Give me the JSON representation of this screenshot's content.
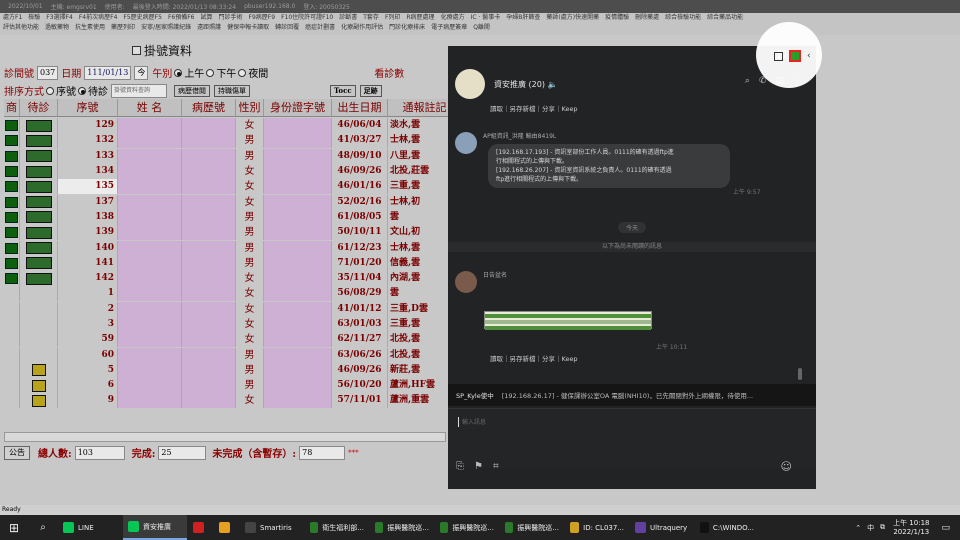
{
  "titlebar": {
    "items": [
      "2022/10/01",
      "主機: emgsrv01",
      "使用者:",
      "最後登入時間: 2022/01/13 08:33:24",
      "pbuser192.168.0",
      "登入: 20050325"
    ]
  },
  "menu": {
    "row1": [
      "處方F1",
      "檢驗",
      "F3選擇F4",
      "F4前次病歷F4",
      "F5歷史病歷F5",
      "F6預備F6",
      "試算",
      "門診手術",
      "F9病歷F9",
      "F10住院許可證F10",
      "診斷書",
      "T套存",
      "F列印",
      "R病歷處理",
      "化療處方",
      "IC · 醫事卡",
      "孕婦B肝篩查",
      "藥師(處方)快速開藥",
      "疫情體驗",
      "刪除藥處",
      "綜合檢驗功能",
      "綜合藥品功能"
    ],
    "row2": [
      "評估其他功能",
      "過敏藥物",
      "抗生素使用",
      "藥歷列印",
      "安寧/居家照護紀錄",
      "遠距照護",
      "健保申報卡讀取",
      "轉診回覆",
      "癌症計劃書",
      "化療副作用評估",
      "門診化療排床",
      "電子病歷簽章",
      "Q離開"
    ]
  },
  "form": {
    "title": "掛號資料",
    "clinic_label": "診間號",
    "clinic_no": "037",
    "date_label": "日期",
    "date": "111/01/13",
    "today_btn": "今",
    "period_label": "午別",
    "periods": [
      "上午",
      "下午",
      "夜間"
    ],
    "right_label": "看診數",
    "sort_label": "排序方式",
    "sort_options": [
      "序號",
      "待診"
    ],
    "search_placeholder": "掛號資料查詢",
    "btn_history": "病歷借閱",
    "btn_injury": "持職傷單",
    "btn_tocc": "Tocc",
    "btn_foot": "足跡"
  },
  "grid": {
    "headers": [
      "商",
      "待診",
      "序號",
      "姓 名",
      "病歷號",
      "性別",
      "身份證字號",
      "出生日期",
      "通報註記"
    ],
    "rows": [
      {
        "mark": "g",
        "status": "g",
        "no": "129",
        "sex": "女",
        "dob": "46/06/04",
        "note": "淡水,雲"
      },
      {
        "mark": "g",
        "status": "g",
        "no": "132",
        "sex": "男",
        "dob": "41/03/27",
        "note": "士林,雲"
      },
      {
        "mark": "g",
        "status": "g",
        "no": "133",
        "sex": "男",
        "dob": "48/09/10",
        "note": "八里,雲"
      },
      {
        "mark": "g",
        "status": "g",
        "no": "134",
        "sex": "女",
        "dob": "46/09/26",
        "note": "北投,莊雲"
      },
      {
        "mark": "g",
        "status": "g",
        "no": "135",
        "sex": "女",
        "dob": "46/01/16",
        "note": "三重,雲",
        "selected": true
      },
      {
        "mark": "g",
        "status": "g",
        "no": "137",
        "sex": "女",
        "dob": "52/02/16",
        "note": "士林,初"
      },
      {
        "mark": "g",
        "status": "g",
        "no": "138",
        "sex": "男",
        "dob": "61/08/05",
        "note": "雲"
      },
      {
        "mark": "g",
        "status": "g",
        "no": "139",
        "sex": "男",
        "dob": "50/10/11",
        "note": "文山,初"
      },
      {
        "mark": "g",
        "status": "g",
        "no": "140",
        "sex": "男",
        "dob": "61/12/23",
        "note": "士林,雲"
      },
      {
        "mark": "g",
        "status": "g",
        "no": "141",
        "sex": "男",
        "dob": "71/01/20",
        "note": "信義,雲"
      },
      {
        "mark": "g",
        "status": "g",
        "no": "142",
        "sex": "女",
        "dob": "35/11/04",
        "note": "內湖,雲"
      },
      {
        "mark": "",
        "status": "",
        "no": "1",
        "sex": "女",
        "dob": "56/08/29",
        "note": "雲"
      },
      {
        "mark": "",
        "status": "",
        "no": "2",
        "sex": "女",
        "dob": "41/01/12",
        "note": "三重,D雲"
      },
      {
        "mark": "",
        "status": "",
        "no": "3",
        "sex": "女",
        "dob": "63/01/03",
        "note": "三重,雲"
      },
      {
        "mark": "",
        "status": "",
        "no": "59",
        "sex": "女",
        "dob": "62/11/27",
        "note": "北投,雲"
      },
      {
        "mark": "",
        "status": "",
        "no": "60",
        "sex": "男",
        "dob": "63/06/26",
        "note": "北投,雲"
      },
      {
        "mark": "",
        "status": "y",
        "no": "5",
        "sex": "男",
        "dob": "46/09/26",
        "note": "新莊,雲"
      },
      {
        "mark": "",
        "status": "y",
        "no": "6",
        "sex": "男",
        "dob": "56/10/20",
        "note": "蘆洲,HF雲"
      },
      {
        "mark": "",
        "status": "y",
        "no": "9",
        "sex": "女",
        "dob": "57/11/01",
        "note": "蘆洲,重雲"
      }
    ]
  },
  "footer": {
    "announce_btn": "公告",
    "total_label": "總人數:",
    "total": "103",
    "done_label": "完成:",
    "done": "25",
    "undone_label": "未完成（含暫存）:",
    "undone": "78",
    "extra": "***"
  },
  "statusbar": {
    "text": "Ready"
  },
  "chat": {
    "room_name": "資安推廣",
    "member_count": "(20)",
    "actions": "讀取｜另存新檔｜分享｜Keep",
    "sender1": "AP組資訊_洪隆 輸由8419L",
    "bubble_lines": [
      "[192.168.17.193] - 資訊室部份工作人員。0111的確有透過ftp進",
      "行相關程式的上傳與下載。",
      "[192.168.26.207] - 資訊室資訊系統之負責人。0111的確有透過",
      "ftp進行相關程式的上傳與下載。"
    ],
    "time1": "上午 9:57",
    "today": "今天",
    "unread": "以下為尚未閱讀的訊息",
    "sender2": "日告盆名",
    "time2": "上午 10:11",
    "actions2": "讀取｜另存新檔｜分享｜Keep",
    "notice_prefix": "SP_Kyle使中",
    "notice_text": "[192.168.26.17] - 健保課辦公室OA 電腦(NHI10)，已先關閉對外上網權限，待使用...",
    "input_placeholder": "輸入訊息"
  },
  "taskbar": {
    "items": [
      {
        "label": "LINE",
        "color": "#06c755"
      },
      {
        "label": "資安推廣",
        "color": "#06c755",
        "active": true
      },
      {
        "label": "",
        "color": "#d02020"
      },
      {
        "label": "",
        "color": "#e8a020"
      },
      {
        "label": "Smartiris",
        "color": "#444"
      },
      {
        "label": "衛生福利部...",
        "color": "#2a7a2a"
      },
      {
        "label": "振興醫院巡...",
        "color": "#2a7a2a"
      },
      {
        "label": "振興醫院巡...",
        "color": "#2a7a2a"
      },
      {
        "label": "振興醫院巡...",
        "color": "#2a7a2a"
      },
      {
        "label": "ID: CL037...",
        "color": "#d0a020"
      },
      {
        "label": "Ultraquery",
        "color": "#6040a0"
      },
      {
        "label": "C:\\WINDO...",
        "color": "#111"
      }
    ],
    "ime": "中",
    "time": "上午 10:18",
    "date": "2022/1/13"
  }
}
